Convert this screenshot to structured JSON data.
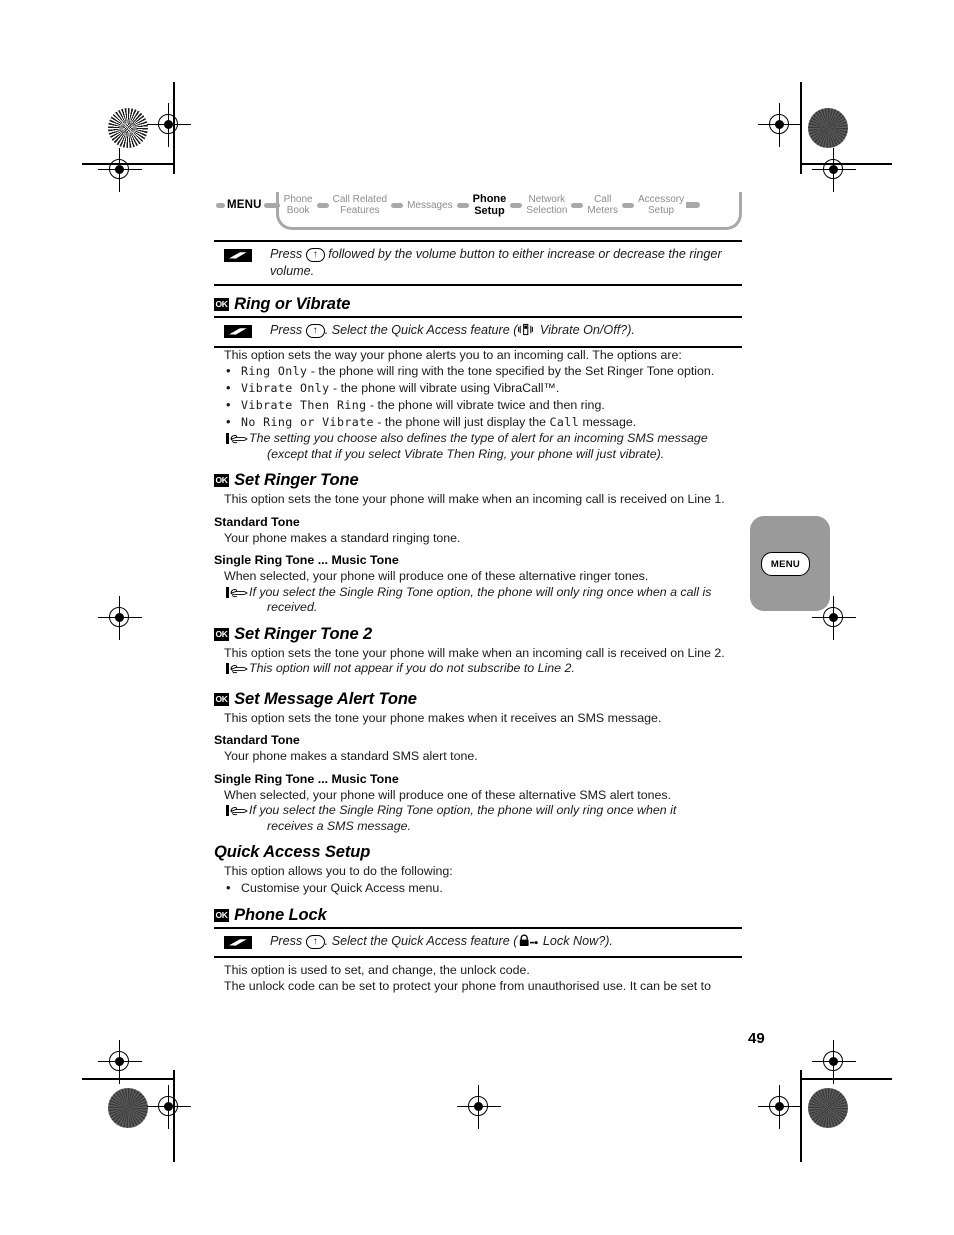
{
  "page": {
    "number": "49"
  },
  "breadcrumb": {
    "menu_label": "MENU",
    "items": [
      {
        "line1": "Phone",
        "line2": "Book",
        "active": false
      },
      {
        "line1": "Call Related",
        "line2": "Features",
        "active": false
      },
      {
        "line1": "Messages",
        "line2": "",
        "active": false
      },
      {
        "line1": "Phone",
        "line2": "Setup",
        "active": true
      },
      {
        "line1": "Network",
        "line2": "Selection",
        "active": false
      },
      {
        "line1": "Call",
        "line2": "Meters",
        "active": false
      },
      {
        "line1": "Accessory",
        "line2": "Setup",
        "active": false
      }
    ],
    "active_color": "#000000",
    "inactive_color": "#8d8d8d",
    "trail_color": "#a8a8a8"
  },
  "side_tab": {
    "label": "MENU",
    "background_color": "#9a9a9a"
  },
  "callout_volume": {
    "icon": "lightning-bolt-icon",
    "text_before_key": "Press",
    "key_label": "↑",
    "text_after_key": " followed by the volume button to either increase or decrease the ringer volume."
  },
  "sections": {
    "ring_or_vibrate": {
      "badge": "OK",
      "title": "Ring or Vibrate",
      "callout": {
        "icon": "lightning-bolt-icon",
        "text_before_key": "Press",
        "key_label": "↑",
        "text_mid": ". Select the Quick Access feature (",
        "feature_icon": "vibrate-phone-icon",
        "text_after": " Vibrate On/Off?)."
      },
      "intro": "This option sets the way your phone alerts you to an incoming call. The options are:",
      "options": [
        {
          "code": "Ring Only",
          "desc": " - the phone will ring with the tone specified by the Set Ringer Tone option."
        },
        {
          "code": "Vibrate Only",
          "desc": " - the phone will vibrate using VibraCall™."
        },
        {
          "code": "Vibrate Then Ring",
          "desc": " - the phone will vibrate twice and then ring."
        },
        {
          "code": "No Ring or Vibrate",
          "desc_pre": " - the phone will just display the ",
          "code2": "Call",
          "desc_post": " message."
        }
      ],
      "note": {
        "icon": "pointing-hand-icon",
        "line1": "The setting you choose also defines the type of alert for an incoming SMS message",
        "line2": "(except that if you select Vibrate Then Ring, your phone will just vibrate)."
      }
    },
    "set_ringer_tone": {
      "badge": "OK",
      "title": "Set Ringer Tone",
      "intro": "This option sets the tone your phone will make when an incoming call is received on Line 1.",
      "sub1_title": "Standard Tone",
      "sub1_body": "Your phone makes a standard ringing tone.",
      "sub2_title": "Single Ring Tone ... Music Tone",
      "sub2_body": "When selected, your phone will produce one of these alternative ringer tones.",
      "note": {
        "icon": "pointing-hand-icon",
        "line1": "If you select the Single Ring Tone option, the phone will only ring once when a call is",
        "line2": "received."
      }
    },
    "set_ringer_tone_2": {
      "badge": "OK",
      "title": "Set Ringer Tone 2",
      "intro": "This option sets the tone your phone will make when an incoming call is received on Line 2.",
      "note": {
        "icon": "pointing-hand-icon",
        "line1": "This option will not appear if you do not subscribe to Line 2.",
        "line2": ""
      }
    },
    "set_message_alert_tone": {
      "badge": "OK",
      "title": "Set Message Alert Tone",
      "intro": "This option sets the tone your phone makes when it receives an SMS message.",
      "sub1_title": "Standard Tone",
      "sub1_body": "Your phone makes a standard SMS alert tone.",
      "sub2_title": "Single Ring Tone ... Music Tone",
      "sub2_body": "When selected, your phone will produce one of these alternative SMS alert tones.",
      "note": {
        "icon": "pointing-hand-icon",
        "line1": "If you select the Single Ring Tone option, the phone will only ring once when it",
        "line2": "receives a SMS message."
      }
    },
    "quick_access_setup": {
      "title": "Quick Access Setup",
      "intro": "This option allows you to do the following:",
      "bullets": [
        "Customise your Quick Access menu."
      ]
    },
    "phone_lock": {
      "badge": "OK",
      "title": "Phone Lock",
      "callout": {
        "icon": "lightning-bolt-icon",
        "text_before_key": "Press",
        "key_label": "↑",
        "text_mid": ". Select the Quick Access feature (",
        "feature_icon": "padlock-icon",
        "text_after": " Lock Now?)."
      },
      "body_line1": "This option is used to set, and change, the unlock code.",
      "body_line2": "The unlock code can be set to protect your phone from unauthorised use. It can be set to"
    }
  }
}
